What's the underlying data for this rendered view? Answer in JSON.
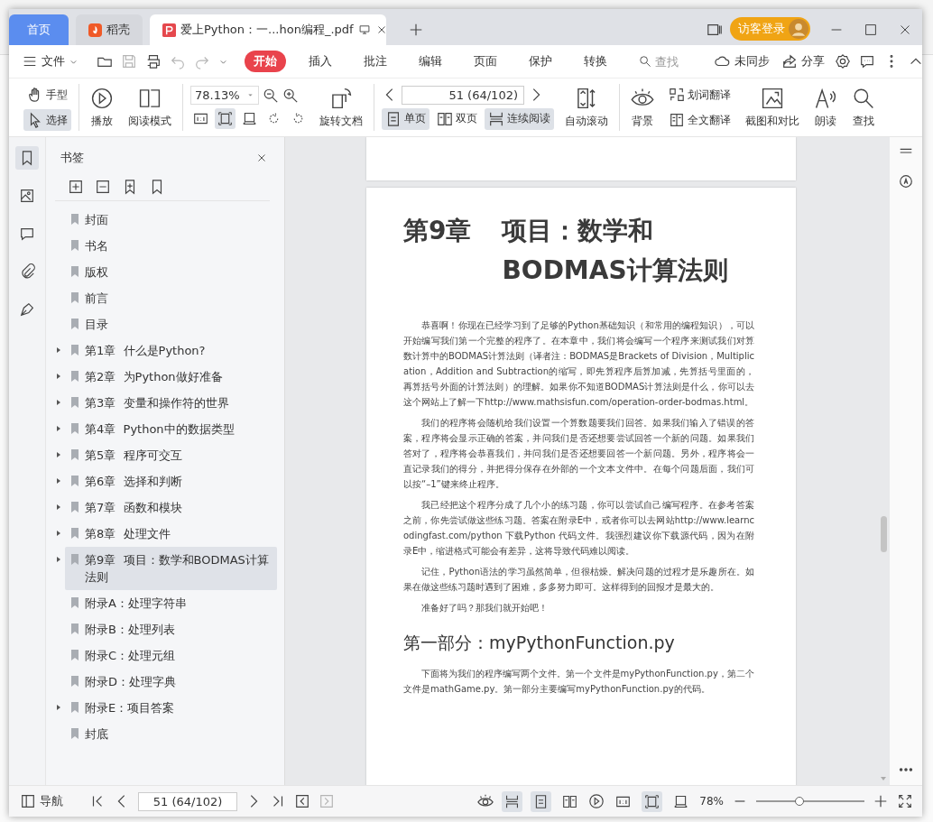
{
  "tabs": [
    {
      "label": "首页",
      "kind": "home",
      "selected": false
    },
    {
      "label": "稻壳",
      "kind": "app",
      "selected": false
    },
    {
      "label": "爱上Python：一...hon编程_.pdf",
      "kind": "doc",
      "selected": true
    }
  ],
  "account": {
    "label": "访客登录"
  },
  "menu": {
    "file": "文件",
    "items": [
      {
        "label": "开始",
        "selected": true
      },
      {
        "label": "插入",
        "selected": false
      },
      {
        "label": "批注",
        "selected": false
      },
      {
        "label": "编辑",
        "selected": false
      },
      {
        "label": "页面",
        "selected": false
      },
      {
        "label": "保护",
        "selected": false
      },
      {
        "label": "转换",
        "selected": false
      }
    ],
    "search_placeholder": "查找",
    "sync": "未同步",
    "share": "分享"
  },
  "toolbar": {
    "hand": {
      "label": "手型",
      "selected": false
    },
    "select": {
      "label": "选择",
      "selected": true
    },
    "play": "播放",
    "read_mode": "阅读模式",
    "zoom": "78.13%",
    "view_modes": [
      {
        "kind": "actual",
        "selected": false
      },
      {
        "kind": "fit-page",
        "selected": true
      },
      {
        "kind": "fit-width",
        "selected": false
      }
    ],
    "rotate": "旋转文档",
    "page": "51 (64/102)",
    "layouts": [
      {
        "label": "单页",
        "kind": "single",
        "selected": true
      },
      {
        "label": "双页",
        "kind": "double",
        "selected": false
      },
      {
        "label": "连续阅读",
        "kind": "continuous",
        "selected": true
      }
    ],
    "auto_scroll": "自动滚动",
    "background": "背景",
    "word_translate": "划词翻译",
    "full_translate": "全文翻译",
    "screenshot": "截图和对比",
    "read_aloud": "朗读",
    "find": "查找"
  },
  "sidebar": {
    "title": "书签",
    "items": [
      {
        "label": "封面",
        "kind": "leaf",
        "selected": false
      },
      {
        "label": "书名",
        "kind": "leaf",
        "selected": false
      },
      {
        "label": "版权",
        "kind": "leaf",
        "selected": false
      },
      {
        "label": "前言",
        "kind": "leaf",
        "selected": false
      },
      {
        "label": "目录",
        "kind": "leaf",
        "selected": false
      },
      {
        "label": "第1章  什么是Python?",
        "kind": "folder",
        "selected": false
      },
      {
        "label": "第2章  为Python做好准备",
        "kind": "folder",
        "selected": false
      },
      {
        "label": "第3章  变量和操作符的世界",
        "kind": "folder",
        "selected": false
      },
      {
        "label": "第4章  Python中的数据类型",
        "kind": "folder",
        "selected": false
      },
      {
        "label": "第5章  程序可交互",
        "kind": "folder",
        "selected": false
      },
      {
        "label": "第6章  选择和判断",
        "kind": "folder",
        "selected": false
      },
      {
        "label": "第7章  函数和模块",
        "kind": "folder",
        "selected": false
      },
      {
        "label": "第8章  处理文件",
        "kind": "folder",
        "selected": false
      },
      {
        "label": "第9章  项目：数学和BODMAS计算法则",
        "kind": "folder",
        "selected": true
      },
      {
        "label": "附录A：处理字符串",
        "kind": "leaf",
        "selected": false
      },
      {
        "label": "附录B：处理列表",
        "kind": "leaf",
        "selected": false
      },
      {
        "label": "附录C：处理元组",
        "kind": "leaf",
        "selected": false
      },
      {
        "label": "附录D：处理字典",
        "kind": "leaf",
        "selected": false
      },
      {
        "label": "附录E：项目答案",
        "kind": "folder",
        "selected": false
      },
      {
        "label": "封底",
        "kind": "leaf",
        "selected": false
      }
    ]
  },
  "document": {
    "chapter": "第9章",
    "title_lines": [
      "项目：数学和",
      "BODMAS计算法则"
    ],
    "paragraphs": [
      "恭喜啊！你现在已经学习到了足够的Python基础知识（和常用的编程知识），可以开始编写我们第一个完整的程序了。在本章中，我们将会编写一个程序来测试我们对算数计算中的BODMAS计算法则（译者注：BODMAS是Brackets of Division，Multiplication，Addition and Subtraction的缩写，即先算程序后算加减，先算括号里面的，再算括号外面的计算法则）的理解。如果你不知道BODMAS计算法则是什么，你可以去这个网站上了解一下http://www.mathsisfun.com/operation-order-bodmas.html。",
      "我们的程序将会随机给我们设置一个算数题要我们回答。如果我们输入了错误的答案，程序将会显示正确的答案，并问我们是否还想要尝试回答一个新的问题。如果我们答对了，程序将会恭喜我们，并问我们是否还想要回答一个新问题。另外，程序将会一直记录我们的得分，并把得分保存在外部的一个文本文件中。在每个问题后面，我们可以按“–1”键来终止程序。",
      "我已经把这个程序分成了几个小的练习题，你可以尝试自己编写程序。在参考答案之前，你先尝试做这些练习题。答案在附录E中，或者你可以去网站http://www.learncodingfast.com/python 下载Python 代码文件。我强烈建议你下载源代码，因为在附录E中，缩进格式可能会有差异，这将导致代码难以阅读。",
      "记住，Python语法的学习虽然简单，但很枯燥。解决问题的过程才是乐趣所在。如果在做这些练习题时遇到了困难，多多努力即可。这样得到的回报才是最大的。",
      "准备好了吗？那我们就开始吧！"
    ],
    "section": "第一部分：myPythonFunction.py",
    "section_paragraphs": [
      "下面将为我们的程序编写两个文件。第一个文件是myPythonFunction.py，第二个文件是mathGame.py。第一部分主要编写myPythonFunction.py的代码。"
    ]
  },
  "status_bar": {
    "nav": "导航",
    "page": "51 (64/102)",
    "zoom": "78%",
    "zoom_slider": {
      "level": 0.4
    },
    "layouts": [
      {
        "kind": "continuous",
        "selected": true
      },
      {
        "kind": "single",
        "selected": true
      },
      {
        "kind": "double",
        "selected": false
      }
    ],
    "view_modes": [
      {
        "kind": "actual",
        "selected": false
      },
      {
        "kind": "fit-page",
        "selected": true
      },
      {
        "kind": "fit-width",
        "selected": false
      }
    ]
  }
}
